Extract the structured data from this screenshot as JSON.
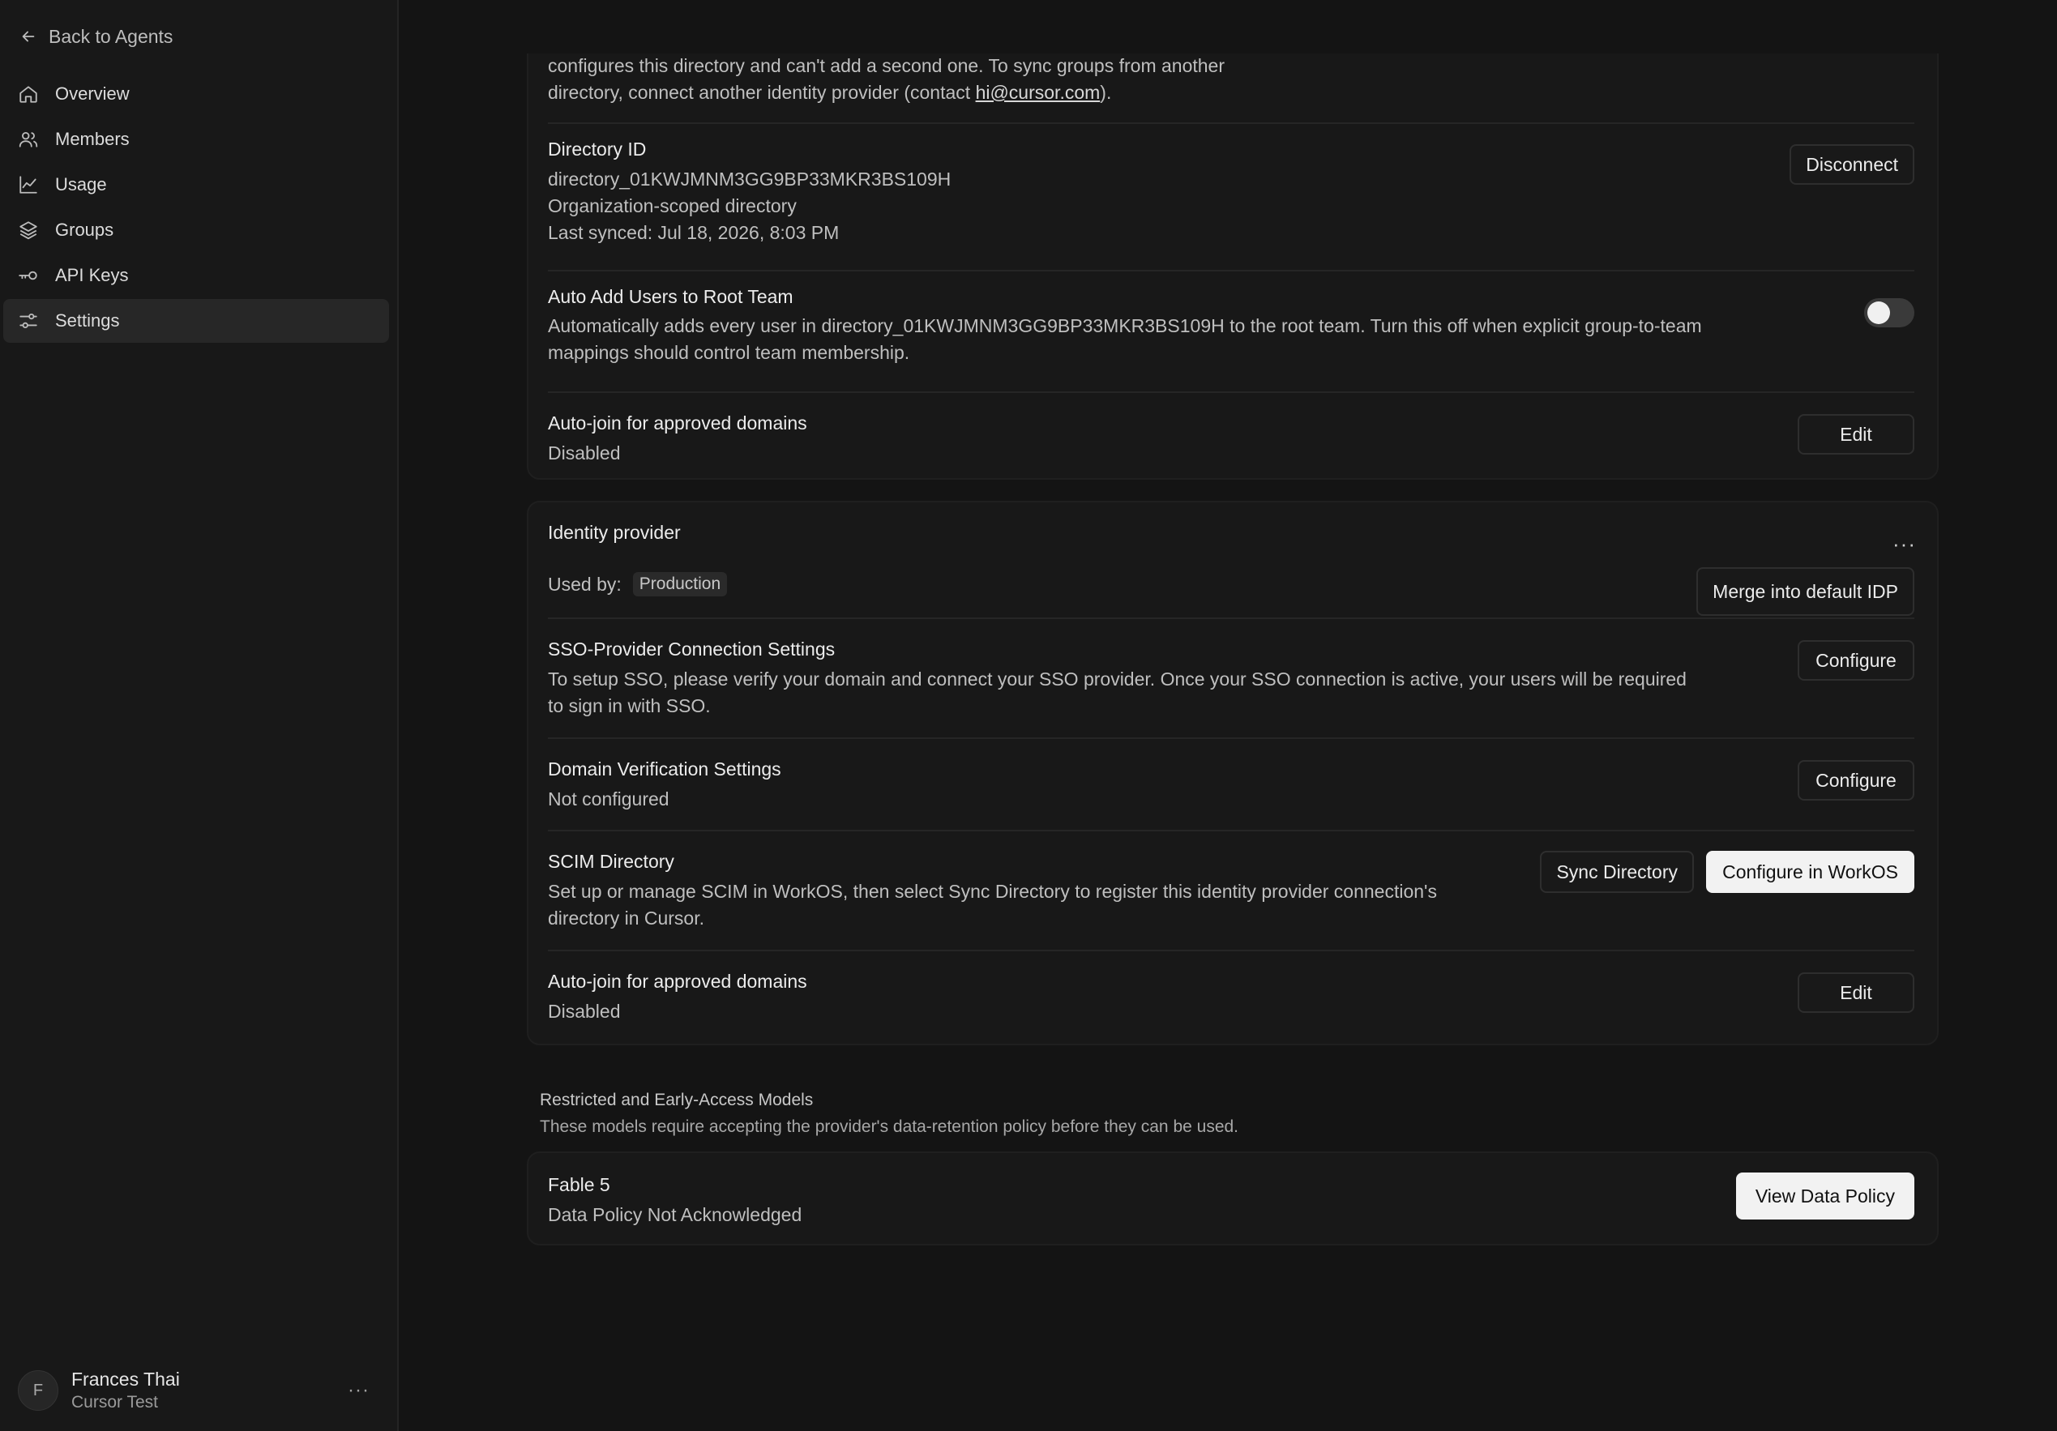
{
  "sidebar": {
    "back_label": "Back to Agents",
    "items": [
      {
        "label": "Overview",
        "icon": "home-icon"
      },
      {
        "label": "Members",
        "icon": "users-icon"
      },
      {
        "label": "Usage",
        "icon": "chart-line-icon"
      },
      {
        "label": "Groups",
        "icon": "layers-icon"
      },
      {
        "label": "API Keys",
        "icon": "key-icon"
      },
      {
        "label": "Settings",
        "icon": "sliders-icon",
        "active": true
      }
    ],
    "user": {
      "initial": "F",
      "name": "Frances Thai",
      "org": "Cursor Test",
      "more": "···"
    }
  },
  "directory_card": {
    "intro_line1": "configures this directory and can't add a second one. To sync groups from another",
    "intro_line2_prefix": "directory, connect another identity provider (contact ",
    "intro_link": "hi@cursor.com",
    "intro_line2_suffix": ").",
    "directory": {
      "title": "Directory ID",
      "id": "directory_01KWJMNM3GG9BP33MKR3BS109H",
      "scope": "Organization-scoped directory",
      "last_synced": "Last synced: Jul 18, 2026, 8:03 PM",
      "button": "Disconnect"
    },
    "auto_add": {
      "title": "Auto Add Users to Root Team",
      "desc_line1": "Automatically adds every user in directory_01KWJMNM3GG9BP33MKR3BS109H to the root team. Turn this off when explicit group-to-team",
      "desc_line2": "mappings should control team membership.",
      "enabled": false
    },
    "auto_join": {
      "title": "Auto-join for approved domains",
      "status": "Disabled",
      "button": "Edit"
    }
  },
  "idp_card": {
    "title": "Identity provider",
    "more": "···",
    "used_by_label": "Used by:",
    "used_by_badge": "Production",
    "merge_button": "Merge into default IDP",
    "sso": {
      "title": "SSO-Provider Connection Settings",
      "desc_line1": "To setup SSO, please verify your domain and connect your SSO provider. Once your SSO connection is active, your users will be required",
      "desc_line2": "to sign in with SSO.",
      "button": "Configure"
    },
    "domain": {
      "title": "Domain Verification Settings",
      "status": "Not configured",
      "button": "Configure"
    },
    "scim": {
      "title": "SCIM Directory",
      "desc_line1": "Set up or manage SCIM in WorkOS, then select Sync Directory to register this identity provider connection's",
      "desc_line2": "directory in Cursor.",
      "sync_button": "Sync Directory",
      "configure_button": "Configure in WorkOS"
    },
    "auto_join": {
      "title": "Auto-join for approved domains",
      "status": "Disabled",
      "button": "Edit"
    }
  },
  "models_section": {
    "title": "Restricted and Early-Access Models",
    "subtitle": "These models require accepting the provider's data-retention policy before they can be used.",
    "model": {
      "name": "Fable 5",
      "status": "Data Policy Not Acknowledged",
      "button": "View Data Policy"
    }
  }
}
